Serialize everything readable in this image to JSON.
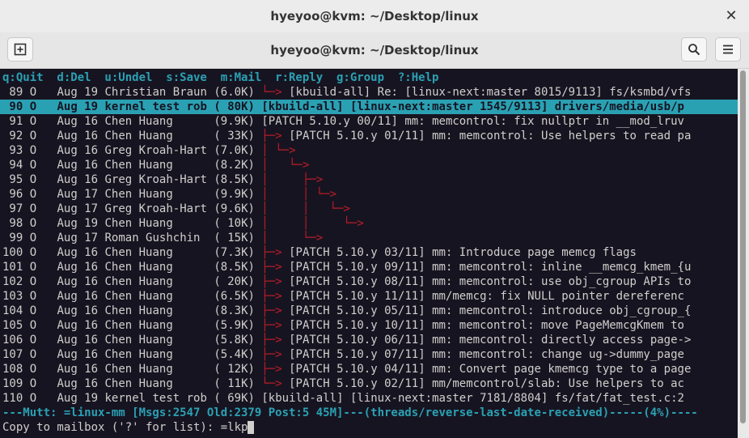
{
  "window": {
    "title": "hyeyoo@kvm: ~/Desktop/linux",
    "close_glyph": "✕"
  },
  "header": {
    "title": "hyeyoo@kvm: ~/Desktop/linux"
  },
  "terminal": {
    "helpbar": "q:Quit  d:Del  u:Undel  s:Save  m:Mail  r:Reply  g:Group  ?:Help",
    "rows": [
      {
        "num": " 89",
        "flag": "O",
        "date": "Aug 19",
        "from": "Christian Braun",
        "size": "(6.0K)",
        "tree": " └─>",
        "subject": "[kbuild-all] Re: [linux-next:master 8015/9113] fs/ksmbd/vfs"
      },
      {
        "num": " 90",
        "flag": "O",
        "date": "Aug 19",
        "from": "kernel test rob",
        "size": "( 80K)",
        "tree": "",
        "subject": "[kbuild-all] [linux-next:master 1545/9113] drivers/media/usb/p"
      },
      {
        "num": " 91",
        "flag": "O",
        "date": "Aug 16",
        "from": "Chen Huang     ",
        "size": "(9.9K)",
        "tree": "",
        "subject": "[PATCH 5.10.y 00/11] mm: memcontrol: fix nullptr in __mod_lruv"
      },
      {
        "num": " 92",
        "flag": "O",
        "date": "Aug 16",
        "from": "Chen Huang     ",
        "size": "( 33K)",
        "tree": " ├─>",
        "subject": "[PATCH 5.10.y 01/11] mm: memcontrol: Use helpers to read pa"
      },
      {
        "num": " 93",
        "flag": "O",
        "date": "Aug 16",
        "from": "Greg Kroah-Hart",
        "size": "(7.0K)",
        "tree": " │ └─>",
        "subject": ""
      },
      {
        "num": " 94",
        "flag": "O",
        "date": "Aug 16",
        "from": "Chen Huang     ",
        "size": "(8.2K)",
        "tree": " │   └─>",
        "subject": ""
      },
      {
        "num": " 95",
        "flag": "O",
        "date": "Aug 16",
        "from": "Greg Kroah-Hart",
        "size": "(8.5K)",
        "tree": " │     ├─>",
        "subject": ""
      },
      {
        "num": " 96",
        "flag": "O",
        "date": "Aug 17",
        "from": "Chen Huang     ",
        "size": "(9.9K)",
        "tree": " │     │ └─>",
        "subject": ""
      },
      {
        "num": " 97",
        "flag": "O",
        "date": "Aug 17",
        "from": "Greg Kroah-Hart",
        "size": "(9.6K)",
        "tree": " │     │   └─>",
        "subject": ""
      },
      {
        "num": " 98",
        "flag": "O",
        "date": "Aug 19",
        "from": "Chen Huang     ",
        "size": "( 10K)",
        "tree": " │     │     └─>",
        "subject": ""
      },
      {
        "num": " 99",
        "flag": "O",
        "date": "Aug 17",
        "from": "Roman Gushchin ",
        "size": "( 15K)",
        "tree": " │     └─>",
        "subject": ""
      },
      {
        "num": "100",
        "flag": "O",
        "date": "Aug 16",
        "from": "Chen Huang     ",
        "size": "(7.3K)",
        "tree": " ├─>",
        "subject": "[PATCH 5.10.y 03/11] mm: Introduce page memcg flags"
      },
      {
        "num": "101",
        "flag": "O",
        "date": "Aug 16",
        "from": "Chen Huang     ",
        "size": "(8.5K)",
        "tree": " ├─>",
        "subject": "[PATCH 5.10.y 09/11] mm: memcontrol: inline __memcg_kmem_{u"
      },
      {
        "num": "102",
        "flag": "O",
        "date": "Aug 16",
        "from": "Chen Huang     ",
        "size": "( 20K)",
        "tree": " ├─>",
        "subject": "[PATCH 5.10.y 08/11] mm: memcontrol: use obj_cgroup APIs to"
      },
      {
        "num": "103",
        "flag": "O",
        "date": "Aug 16",
        "from": "Chen Huang     ",
        "size": "(6.5K)",
        "tree": " ├─>",
        "subject": "[PATCH 5.10.y 11/11] mm/memcg: fix NULL pointer dereferenc"
      },
      {
        "num": "104",
        "flag": "O",
        "date": "Aug 16",
        "from": "Chen Huang     ",
        "size": "(8.3K)",
        "tree": " ├─>",
        "subject": "[PATCH 5.10.y 05/11] mm: memcontrol: introduce obj_cgroup_{"
      },
      {
        "num": "105",
        "flag": "O",
        "date": "Aug 16",
        "from": "Chen Huang     ",
        "size": "(5.9K)",
        "tree": " ├─>",
        "subject": "[PATCH 5.10.y 10/11] mm: memcontrol: move PageMemcgKmem to"
      },
      {
        "num": "106",
        "flag": "O",
        "date": "Aug 16",
        "from": "Chen Huang     ",
        "size": "(5.8K)",
        "tree": " ├─>",
        "subject": "[PATCH 5.10.y 06/11] mm: memcontrol: directly access page->"
      },
      {
        "num": "107",
        "flag": "O",
        "date": "Aug 16",
        "from": "Chen Huang     ",
        "size": "(5.4K)",
        "tree": " ├─>",
        "subject": "[PATCH 5.10.y 07/11] mm: memcontrol: change ug->dummy_page"
      },
      {
        "num": "108",
        "flag": "O",
        "date": "Aug 16",
        "from": "Chen Huang     ",
        "size": "( 12K)",
        "tree": " ├─>",
        "subject": "[PATCH 5.10.y 04/11] mm: Convert page kmemcg type to a page"
      },
      {
        "num": "109",
        "flag": "O",
        "date": "Aug 16",
        "from": "Chen Huang     ",
        "size": "( 11K)",
        "tree": " └─>",
        "subject": "[PATCH 5.10.y 02/11] mm/memcontrol/slab: Use helpers to ac"
      },
      {
        "num": "110",
        "flag": "O",
        "date": "Aug 19",
        "from": "kernel test rob",
        "size": "( 69K)",
        "tree": "",
        "subject": "[kbuild-all] [linux-next:master 7181/8804] fs/fat/fat_test.c:2"
      }
    ],
    "selected_row_index": 1,
    "status_line": "---Mutt: =linux-mm [Msgs:2547 Old:2379 Post:5 45M]---(threads/reverse-last-date-received)-----(4%)----",
    "prompt": "Copy to mailbox ('?' for list): =lkp"
  }
}
